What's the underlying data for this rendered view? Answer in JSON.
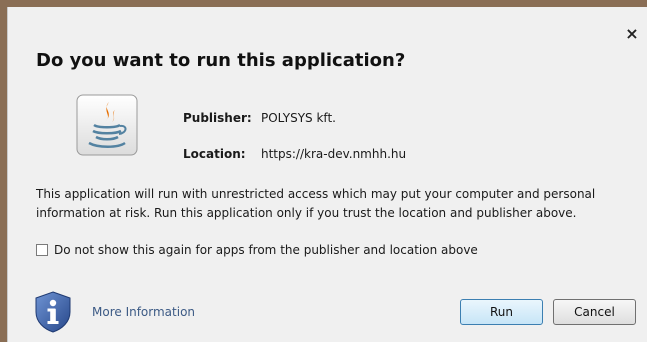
{
  "dialog": {
    "close_symbol": "×",
    "title": "Do you want to run this application?",
    "app_icon": "java-icon",
    "publisher_label": "Publisher:",
    "publisher_value": "POLYSYS kft.",
    "location_label": "Location:",
    "location_value": "https://kra-dev.nmhh.hu",
    "warning_line1": "This application will run with unrestricted access which may put your computer and personal",
    "warning_line2": "information at risk. Run this application only if you trust the location and publisher above.",
    "checkbox_label": "Do not show this again for apps from the publisher and location above",
    "checkbox_checked": false,
    "info_icon": "shield-info-icon",
    "more_info_link": "More Information",
    "run_button": "Run",
    "cancel_button": "Cancel"
  },
  "colors": {
    "frame": "#8a6e55",
    "link": "#3c5a85",
    "shield": "#3a62a8",
    "java_orange": "#e76f00",
    "java_blue": "#5382a1"
  }
}
